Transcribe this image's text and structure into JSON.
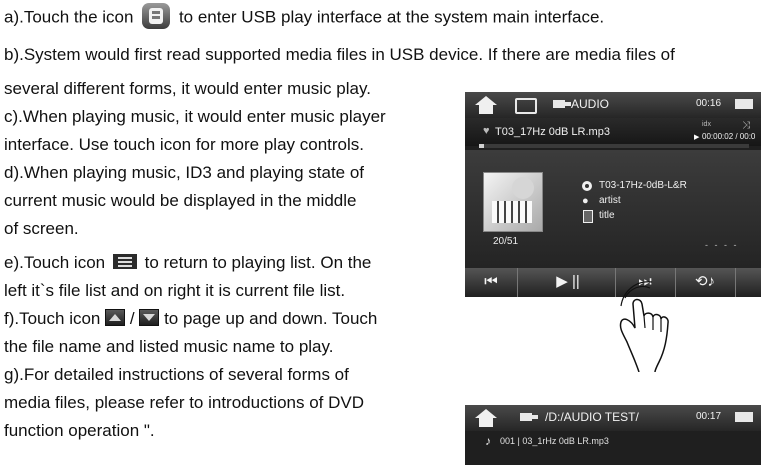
{
  "document": {
    "lines": [
      "a).Touch the icon",
      "to enter USB play interface at the system main interface.",
      "b).System would first read supported media files in USB device. If there are media files of",
      "several different forms, it would enter music play.",
      "c).When playing music, it would enter music player",
      "interface. Use touch icon for more play controls.",
      "d).When playing music, ID3 and playing state of",
      "current music would be displayed in the middle",
      "of screen.",
      "e).Touch icon",
      "to return to playing list. On the",
      "left it`s file list and on right it is current file list.",
      "f).Touch icon",
      "/",
      "to page up and down. Touch",
      "the file name and listed music name to play.",
      "g).For detailed instructions of several forms of",
      "media files, please refer to introductions of DVD",
      "function operation \"."
    ],
    "icons": [
      "usb-icon",
      "list-icon",
      "page-up-icon",
      "page-down-icon"
    ]
  },
  "screenshots": {
    "music_player": {
      "source": "AUDIO",
      "time": "00:16",
      "file_name": "T03_17Hz 0dB LR.mp3",
      "elapsed": "00:00:02 / 00:0",
      "volume_label": "idx",
      "progress_fraction": 0.02,
      "track_count": "20/51",
      "song": "T03-17Hz-0dB-L&R",
      "artist": "artist",
      "title": "title",
      "dots": "- - - -",
      "controls": [
        "⏮",
        "▶ ||",
        "⏭",
        "⟲♪"
      ]
    },
    "file_list": {
      "path": "/D:/AUDIO TEST/",
      "time": "00:17",
      "row": "001 | 03_1rHz 0dB LR.mp3"
    }
  },
  "colors": {
    "panel_bg": "#1f1f1f",
    "header_bg": "#4a4a4a",
    "text_on_dark": "#f0f0f0"
  }
}
